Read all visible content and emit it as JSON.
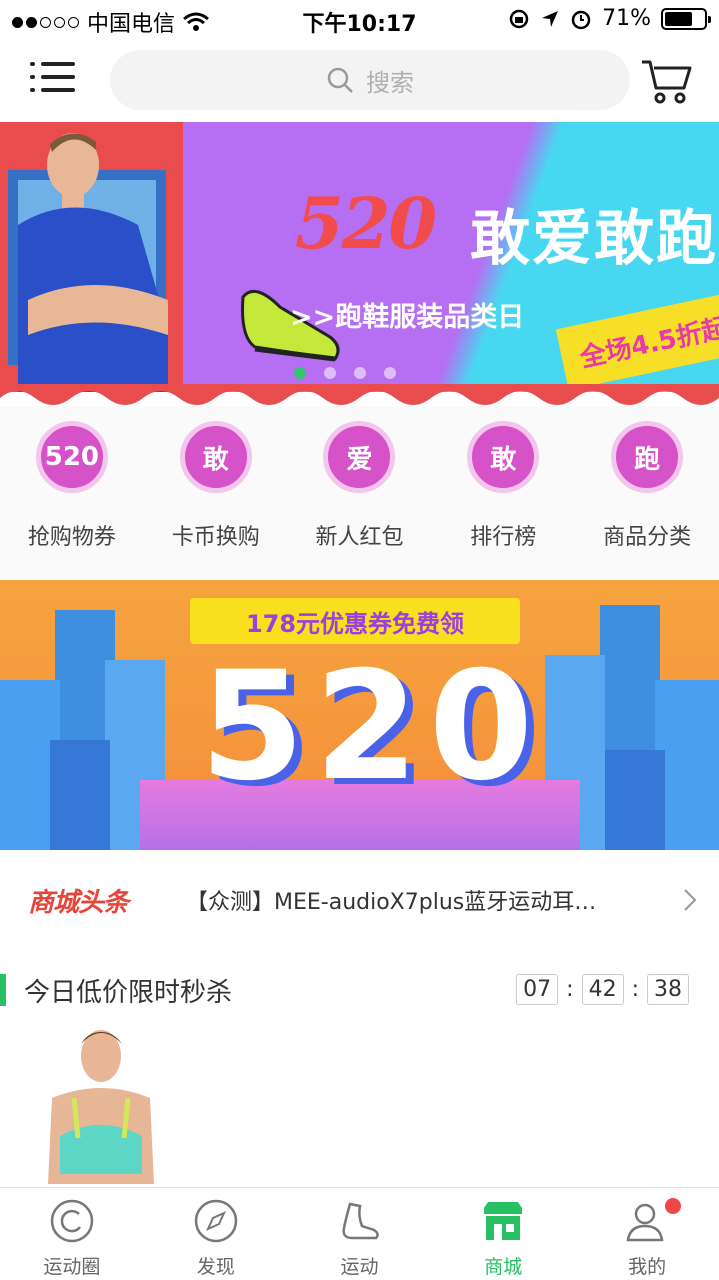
{
  "status_bar": {
    "carrier": "中国电信",
    "time": "下午10:17",
    "battery": "71%"
  },
  "header": {
    "search_placeholder": "搜索"
  },
  "hero_banner": {
    "title_number": "520",
    "title_text": "敢爱敢跑",
    "subtitle": ">>跑鞋服装品类日",
    "badge": "全场4.5折起"
  },
  "quick_entries": [
    {
      "icon_text": "520",
      "label": "抢购物券"
    },
    {
      "icon_text": "敢",
      "label": "卡币换购"
    },
    {
      "icon_text": "爱",
      "label": "新人红包"
    },
    {
      "icon_text": "敢",
      "label": "排行榜"
    },
    {
      "icon_text": "跑",
      "label": "商品分类"
    }
  ],
  "promo_banner": {
    "ribbon": "178元优惠券免费领",
    "big_text": "520"
  },
  "news": {
    "logo": "商城头条",
    "headline": "【众测】MEE-audioX7plus蓝牙运动耳…"
  },
  "flash_sale": {
    "title": "今日低价限时秒杀",
    "hours": "07",
    "minutes": "42",
    "seconds": "38",
    "separator": ":"
  },
  "tabbar": [
    {
      "label": "运动圈",
      "icon": "sport-circle-icon"
    },
    {
      "label": "发现",
      "icon": "compass-icon"
    },
    {
      "label": "运动",
      "icon": "shoe-icon"
    },
    {
      "label": "商城",
      "icon": "store-icon",
      "active": true
    },
    {
      "label": "我的",
      "icon": "profile-icon"
    }
  ],
  "colors": {
    "accent_green": "#27c063",
    "quick_purple": "#d552c9",
    "hero_purple": "#b66ef3",
    "hero_cyan": "#48d7f0"
  }
}
